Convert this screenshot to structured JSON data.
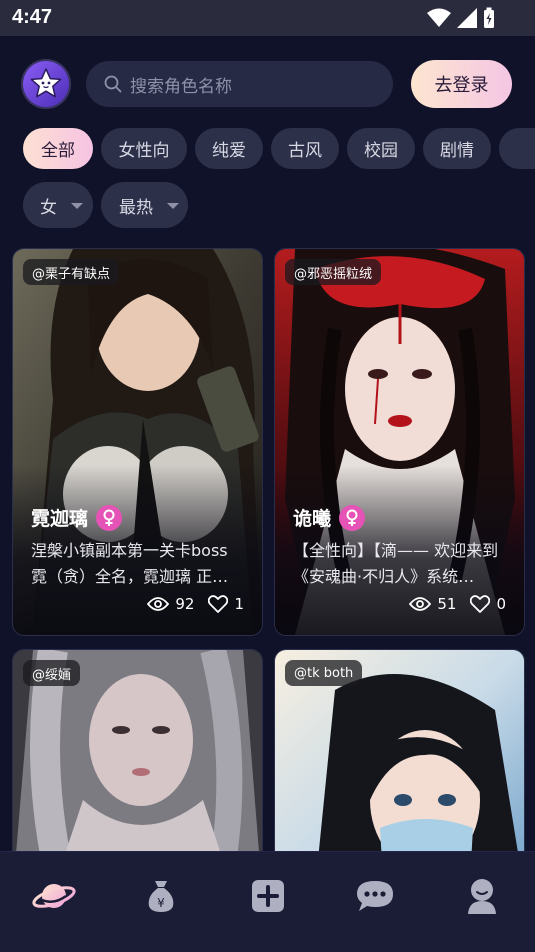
{
  "status_bar": {
    "time": "4:47"
  },
  "header": {
    "logo_icon": "star-face-logo",
    "search_placeholder": "搜索角色名称",
    "login_label": "去登录"
  },
  "tabs": [
    {
      "label": "全部",
      "active": true
    },
    {
      "label": "女性向",
      "active": false
    },
    {
      "label": "纯爱",
      "active": false
    },
    {
      "label": "古风",
      "active": false
    },
    {
      "label": "校园",
      "active": false
    },
    {
      "label": "剧情",
      "active": false
    }
  ],
  "filters": {
    "gender": "女",
    "sort": "最热"
  },
  "cards": [
    {
      "author": "@栗子有缺点",
      "name": "霓迦璃",
      "desc": "涅槃小镇副本第一关卡boss 霓（贪）全名，霓迦璃 正…",
      "views": "92",
      "likes": "1"
    },
    {
      "author": "@邪恶摇粒绒",
      "name": "诡曦",
      "desc": "【全性向】【滴—— 欢迎来到《安魂曲·不归人》系统…",
      "views": "51",
      "likes": "0"
    },
    {
      "author": "@绥婳"
    },
    {
      "author": "@tk both"
    }
  ],
  "bottom_nav": [
    "planet-icon",
    "money-bag-icon",
    "add-icon",
    "chat-icon",
    "profile-icon"
  ],
  "colors": {
    "background": "#0f1229",
    "accent_pink": "#e553b6",
    "tab_bg": "#2c3049"
  }
}
